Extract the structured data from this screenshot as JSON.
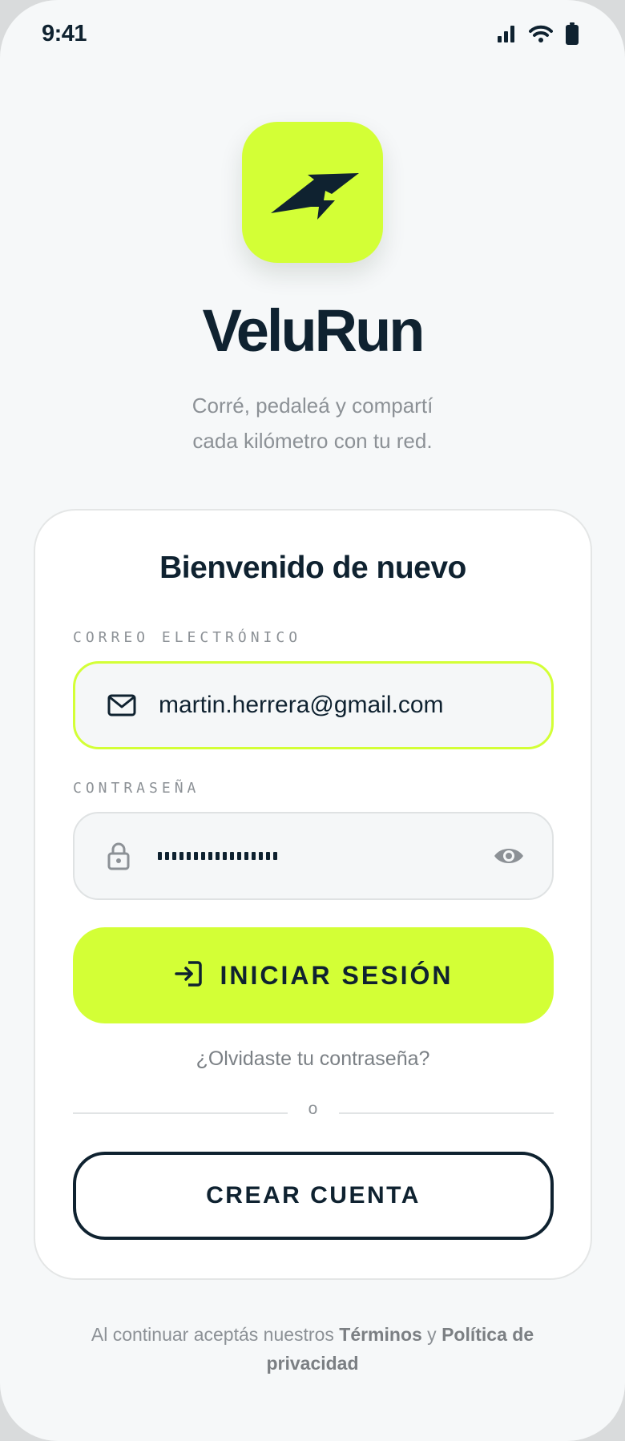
{
  "status_bar": {
    "time": "9:41",
    "icons": [
      "signal-icon",
      "wifi-icon",
      "battery-icon"
    ]
  },
  "brand": {
    "app_name": "VeluRun",
    "tagline_line1": "Corré, pedaleá y compartí",
    "tagline_line2": "cada kilómetro con tu red.",
    "accent_color": "#d3ff36",
    "ink_color": "#0f2230"
  },
  "login_card": {
    "title": "Bienvenido de nuevo",
    "email": {
      "label": "CORREO ELECTRÓNICO",
      "value": "martin.herrera@gmail.com",
      "icon": "mail-icon"
    },
    "password": {
      "label": "CONTRASEÑA",
      "masked_length": 17,
      "icon": "lock-icon",
      "toggle_icon": "eye-icon"
    },
    "login_button": "INICIAR SESIÓN",
    "login_icon": "login-icon",
    "forgot_password": "¿Olvidaste tu contraseña?",
    "divider_text": "o",
    "create_account": "CREAR CUENTA"
  },
  "footer": {
    "prefix": "Al continuar aceptás nuestros ",
    "terms": "Términos",
    "joiner": " y ",
    "privacy": "Política de privacidad"
  }
}
